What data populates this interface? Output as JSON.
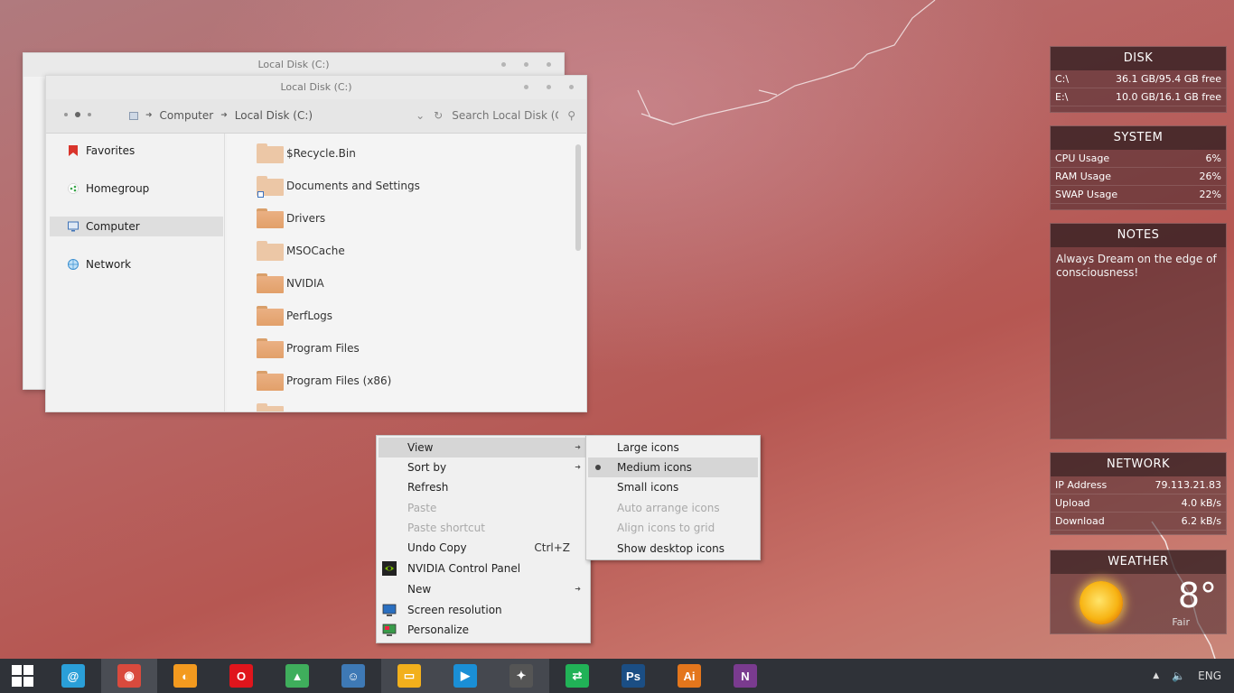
{
  "back_window": {
    "title": "Local Disk (C:)"
  },
  "explorer": {
    "title": "Local Disk (C:)",
    "breadcrumb": [
      "Computer",
      "Local Disk (C:)"
    ],
    "search_placeholder": "Search Local Disk (C:)",
    "sidebar": [
      {
        "label": "Favorites",
        "icon": "bookmark-icon"
      },
      {
        "label": "Homegroup",
        "icon": "homegroup-icon"
      },
      {
        "label": "Computer",
        "icon": "computer-icon",
        "selected": true
      },
      {
        "label": "Network",
        "icon": "network-icon"
      }
    ],
    "files": [
      {
        "name": "$Recycle.Bin",
        "style": "light"
      },
      {
        "name": "Documents and Settings",
        "style": "light",
        "shortcut": true
      },
      {
        "name": "Drivers",
        "style": "dark"
      },
      {
        "name": "MSOCache",
        "style": "light"
      },
      {
        "name": "NVIDIA",
        "style": "dark"
      },
      {
        "name": "PerfLogs",
        "style": "dark"
      },
      {
        "name": "Program Files",
        "style": "dark"
      },
      {
        "name": "Program Files (x86)",
        "style": "dark"
      }
    ]
  },
  "context_menu": {
    "items": [
      {
        "label": "View",
        "submenu": true,
        "highlight": true
      },
      {
        "label": "Sort by",
        "submenu": true
      },
      {
        "label": "Refresh"
      },
      {
        "label": "Paste",
        "disabled": true
      },
      {
        "label": "Paste shortcut",
        "disabled": true
      },
      {
        "label": "Undo Copy",
        "shortcut": "Ctrl+Z"
      },
      {
        "label": "NVIDIA Control Panel",
        "icon": "nvidia-icon"
      },
      {
        "label": "New",
        "submenu": true
      },
      {
        "label": "Screen resolution",
        "icon": "screen-resolution-icon"
      },
      {
        "label": "Personalize",
        "icon": "personalize-icon"
      }
    ]
  },
  "view_submenu": {
    "items": [
      {
        "label": "Large icons"
      },
      {
        "label": "Medium icons",
        "checked": true
      },
      {
        "label": "Small icons"
      },
      {
        "label": "Auto arrange icons",
        "disabled": true
      },
      {
        "label": "Align icons to grid",
        "disabled": true
      },
      {
        "label": "Show desktop icons"
      }
    ]
  },
  "gadgets": {
    "disk": {
      "title": "DISK",
      "rows": [
        {
          "label": "C:\\",
          "value": "36.1 GB/95.4 GB free",
          "fraction": 0.62
        },
        {
          "label": "E:\\",
          "value": "10.0 GB/16.1 GB free",
          "fraction": 0.38
        }
      ]
    },
    "system": {
      "title": "SYSTEM",
      "rows": [
        {
          "label": "CPU Usage",
          "value": "6%",
          "fraction": 0.06
        },
        {
          "label": "RAM Usage",
          "value": "26%",
          "fraction": 0.26
        },
        {
          "label": "SWAP Usage",
          "value": "22%",
          "fraction": 0.22
        }
      ]
    },
    "notes": {
      "title": "NOTES",
      "text": "Always Dream on the edge of consciousness!"
    },
    "network": {
      "title": "NETWORK",
      "rows": [
        {
          "label": "IP Address",
          "value": "79.113.21.83"
        },
        {
          "label": "Upload",
          "value": "4.0 kB/s"
        },
        {
          "label": "Download",
          "value": "6.2 kB/s"
        }
      ]
    },
    "weather": {
      "title": "WEATHER",
      "temp": "8°",
      "condition": "Fair",
      "icon": "sun-icon"
    }
  },
  "taskbar": {
    "apps": [
      {
        "name": "mail-icon",
        "glyph": "@",
        "color": "#2a9fd8"
      },
      {
        "name": "chrome-icon",
        "glyph": "◉",
        "color": "#d94a3d",
        "active": true
      },
      {
        "name": "firefox-icon",
        "glyph": "◐",
        "color": "#f39a1f"
      },
      {
        "name": "opera-icon",
        "glyph": "O",
        "color": "#e0151c"
      },
      {
        "name": "image-viewer-icon",
        "glyph": "▲",
        "color": "#3fae5c"
      },
      {
        "name": "finder-icon",
        "glyph": "☺",
        "color": "#3e79b5"
      },
      {
        "name": "file-explorer-icon",
        "glyph": "▭",
        "color": "#f2b01c",
        "highlight": true
      },
      {
        "name": "media-player-icon",
        "glyph": "▶",
        "color": "#1a8fd6",
        "highlight": true
      },
      {
        "name": "foxit-icon",
        "glyph": "✦",
        "color": "#555",
        "highlight": true
      },
      {
        "name": "remote-desktop-icon",
        "glyph": "⇄",
        "color": "#21b257"
      },
      {
        "name": "photoshop-icon",
        "glyph": "Ps",
        "color": "#1b4e84"
      },
      {
        "name": "illustrator-icon",
        "glyph": "Ai",
        "color": "#e4761c"
      },
      {
        "name": "onenote-icon",
        "glyph": "N",
        "color": "#7a3b8f"
      }
    ],
    "language": "ENG"
  }
}
